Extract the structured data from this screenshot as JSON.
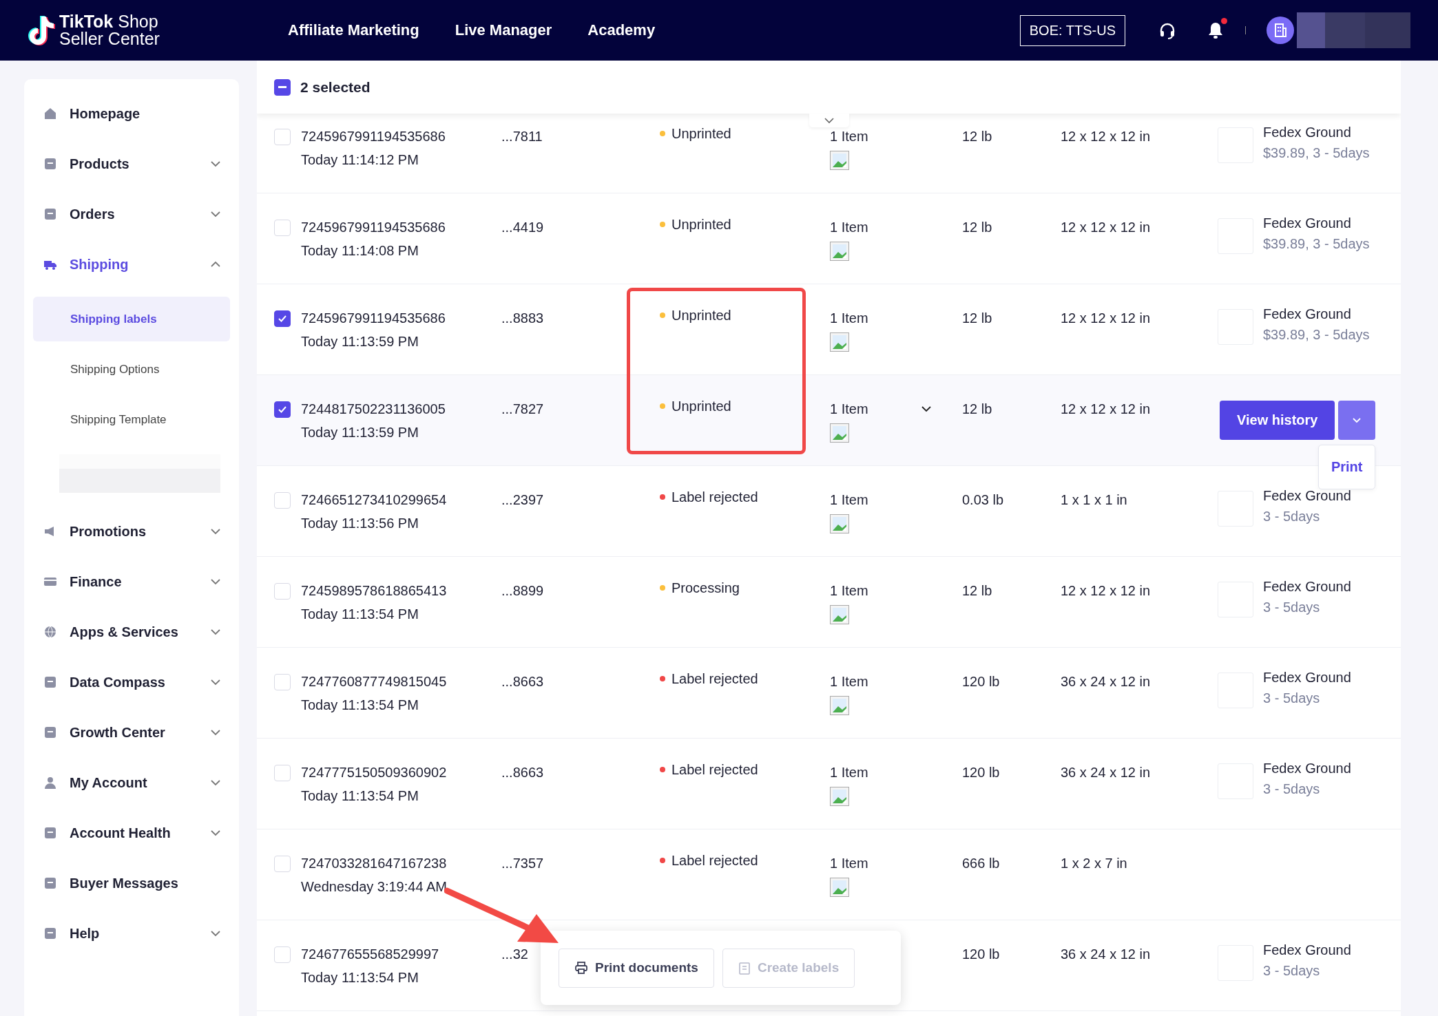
{
  "logo": {
    "brand": "TikTok",
    "product": "Shop",
    "subtitle": "Seller Center"
  },
  "nav": [
    "Affiliate Marketing",
    "Live Manager",
    "Academy"
  ],
  "environment": "BOE: TTS-US",
  "notifications": {
    "unread": true
  },
  "sidebar": {
    "items": [
      {
        "label": "Homepage",
        "selected": false
      },
      {
        "label": "Products",
        "expanded": false,
        "selected": false
      },
      {
        "label": "Orders",
        "expanded": false,
        "selected": false
      },
      {
        "label": "Shipping",
        "expanded": true,
        "selected": true,
        "children": [
          {
            "label": "Shipping labels",
            "selected": true
          },
          {
            "label": "Shipping Options",
            "selected": false
          },
          {
            "label": "Shipping Template",
            "selected": false
          }
        ]
      },
      {
        "label": "Promotions",
        "expanded": false,
        "selected": false
      },
      {
        "label": "Finance",
        "expanded": false,
        "selected": false
      },
      {
        "label": "Apps & Services",
        "expanded": false,
        "selected": false
      },
      {
        "label": "Data Compass",
        "expanded": false,
        "selected": false
      },
      {
        "label": "Growth Center",
        "expanded": false,
        "selected": false
      },
      {
        "label": "My Account",
        "expanded": false,
        "selected": false
      },
      {
        "label": "Account Health",
        "expanded": false,
        "selected": false
      },
      {
        "label": "Buyer Messages",
        "selected": false
      },
      {
        "label": "Help",
        "expanded": false,
        "selected": false
      }
    ]
  },
  "selection": {
    "label": "2 selected",
    "indeterminate": true
  },
  "table": {
    "rows": [
      {
        "checked": false,
        "hovered": false,
        "order_id": "7245967991194535686",
        "time": "Today 11:14:12 PM",
        "short_id": "...7811",
        "status": {
          "text": "Unprinted",
          "color": "#fbbf3c"
        },
        "items": "1 Item",
        "weight": "12 lb",
        "dimensions": "12 x 12 x 12 in",
        "carrier": {
          "name": "Fedex Ground",
          "detail": "$39.89, 3 - 5days"
        }
      },
      {
        "checked": false,
        "hovered": false,
        "order_id": "7245967991194535686",
        "time": "Today 11:14:08 PM",
        "short_id": "...4419",
        "status": {
          "text": "Unprinted",
          "color": "#fbbf3c"
        },
        "items": "1 Item",
        "weight": "12 lb",
        "dimensions": "12 x 12 x 12 in",
        "carrier": {
          "name": "Fedex Ground",
          "detail": "$39.89, 3 - 5days"
        }
      },
      {
        "checked": true,
        "hovered": false,
        "order_id": "7245967991194535686",
        "time": "Today 11:13:59 PM",
        "short_id": "...8883",
        "status": {
          "text": "Unprinted",
          "color": "#fbbf3c"
        },
        "items": "1 Item",
        "weight": "12 lb",
        "dimensions": "12 x 12 x 12 in",
        "carrier": {
          "name": "Fedex Ground",
          "detail": "$39.89, 3 - 5days"
        }
      },
      {
        "checked": true,
        "hovered": true,
        "order_id": "7244817502231136005",
        "time": "Today 11:13:59 PM",
        "short_id": "...7827",
        "status": {
          "text": "Unprinted",
          "color": "#fbbf3c"
        },
        "items": "1 Item",
        "weight": "12 lb",
        "dimensions": "12 x 12 x 12 in",
        "actions": {
          "primary": "View history",
          "menu": [
            "Print"
          ]
        }
      },
      {
        "checked": false,
        "hovered": false,
        "order_id": "7246651273410299654",
        "time": "Today 11:13:56 PM",
        "short_id": "...2397",
        "status": {
          "text": "Label rejected",
          "color": "#f04747"
        },
        "items": "1 Item",
        "weight": "0.03 lb",
        "dimensions": "1 x 1 x 1 in",
        "carrier": {
          "name": "Fedex Ground",
          "detail": "3 - 5days"
        }
      },
      {
        "checked": false,
        "hovered": false,
        "order_id": "7245989578618865413",
        "time": "Today 11:13:54 PM",
        "short_id": "...8899",
        "status": {
          "text": "Processing",
          "color": "#fbbf3c"
        },
        "items": "1 Item",
        "weight": "12 lb",
        "dimensions": "12 x 12 x 12 in",
        "carrier": {
          "name": "Fedex Ground",
          "detail": "3 - 5days"
        }
      },
      {
        "checked": false,
        "hovered": false,
        "order_id": "7247760877749815045",
        "time": "Today 11:13:54 PM",
        "short_id": "...8663",
        "status": {
          "text": "Label rejected",
          "color": "#f04747"
        },
        "items": "1 Item",
        "weight": "120 lb",
        "dimensions": "36 x 24 x 12 in",
        "carrier": {
          "name": "Fedex Ground",
          "detail": "3 - 5days"
        }
      },
      {
        "checked": false,
        "hovered": false,
        "order_id": "7247775150509360902",
        "time": "Today 11:13:54 PM",
        "short_id": "...8663",
        "status": {
          "text": "Label rejected",
          "color": "#f04747"
        },
        "items": "1 Item",
        "weight": "120 lb",
        "dimensions": "36 x 24 x 12 in",
        "carrier": {
          "name": "Fedex Ground",
          "detail": "3 - 5days"
        }
      },
      {
        "checked": false,
        "hovered": false,
        "order_id": "7247033281647167238",
        "time": "Wednesday 3:19:44 AM",
        "short_id": "...7357",
        "status": {
          "text": "Label rejected",
          "color": "#f04747"
        },
        "items": "1 Item",
        "weight": "666 lb",
        "dimensions": "1 x 2 x 7 in"
      },
      {
        "checked": false,
        "hovered": false,
        "order_id": "724677655568529997",
        "time": "Today 11:13:54 PM",
        "short_id": "...32",
        "weight": "120 lb",
        "dimensions": "36 x 24 x 12 in",
        "carrier": {
          "name": "Fedex Ground",
          "detail": "3 - 5days"
        }
      }
    ]
  },
  "bulk_actions": [
    {
      "label": "Print documents",
      "disabled": false
    },
    {
      "label": "Create labels",
      "disabled": true
    }
  ]
}
